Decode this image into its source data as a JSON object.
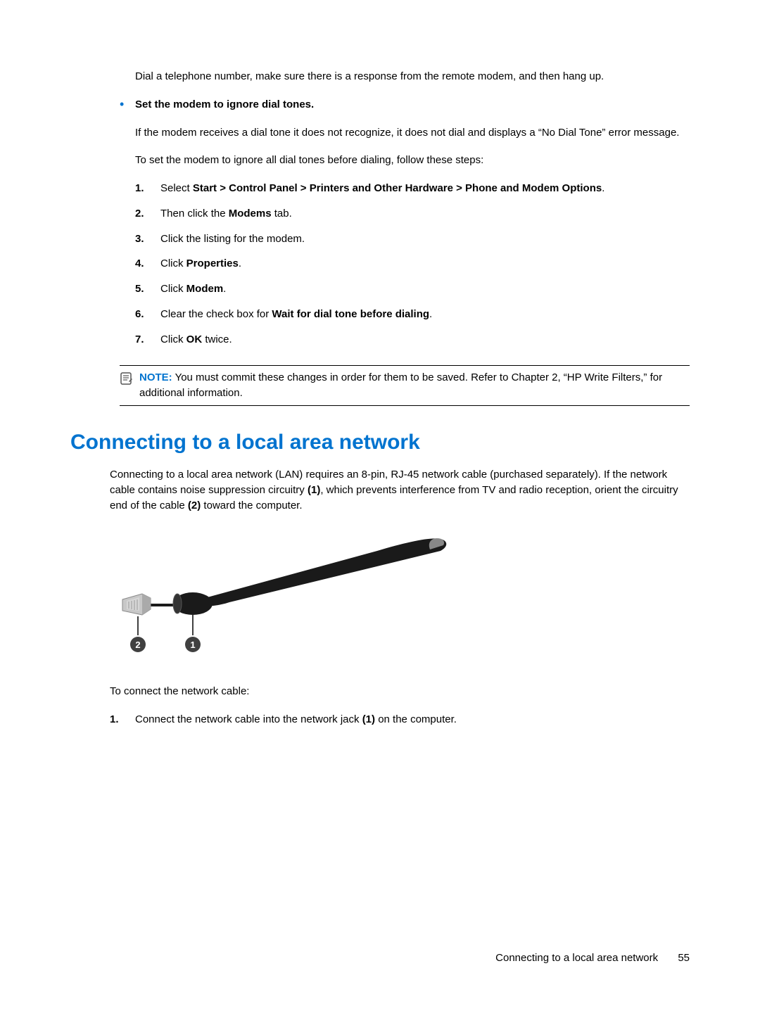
{
  "top": {
    "dial_para": "Dial a telephone number, make sure there is a response from the remote modem, and then hang up.",
    "bullet_title": "Set the modem to ignore dial tones.",
    "bullet_para1": "If the modem receives a dial tone it does not recognize, it does not dial and displays a “No Dial Tone” error message.",
    "bullet_para2": "To set the modem to ignore all dial tones before dialing, follow these steps:",
    "steps": {
      "n1": "1.",
      "s1a": "Select ",
      "s1b": "Start > Control Panel > Printers and Other Hardware > Phone and Modem Options",
      "s1c": ".",
      "n2": "2.",
      "s2a": "Then click the ",
      "s2b": "Modems",
      "s2c": " tab.",
      "n3": "3.",
      "s3": "Click the listing for the modem.",
      "n4": "4.",
      "s4a": "Click ",
      "s4b": "Properties",
      "s4c": ".",
      "n5": "5.",
      "s5a": "Click ",
      "s5b": "Modem",
      "s5c": ".",
      "n6": "6.",
      "s6a": "Clear the check box for ",
      "s6b": "Wait for dial tone before dialing",
      "s6c": ".",
      "n7": "7.",
      "s7a": "Click ",
      "s7b": "OK",
      "s7c": " twice."
    },
    "note_label": "NOTE:",
    "note_text": "   You must commit these changes in order for them to be saved. Refer to Chapter 2, “HP Write Filters,” for additional information."
  },
  "lan": {
    "heading": "Connecting to a local area network",
    "p1a": "Connecting to a local area network (LAN) requires an 8-pin, RJ-45 network cable (purchased separately). If the network cable contains noise suppression circuitry ",
    "p1b": "(1)",
    "p1c": ", which prevents interference from TV and radio reception, orient the circuitry end of the cable ",
    "p1d": "(2)",
    "p1e": " toward the computer.",
    "callout1": "1",
    "callout2": "2",
    "p2": "To connect the network cable:",
    "step1_num": "1.",
    "step1a": "Connect the network cable into the network jack ",
    "step1b": "(1)",
    "step1c": " on the computer."
  },
  "footer": {
    "title": "Connecting to a local area network",
    "page": "55"
  }
}
